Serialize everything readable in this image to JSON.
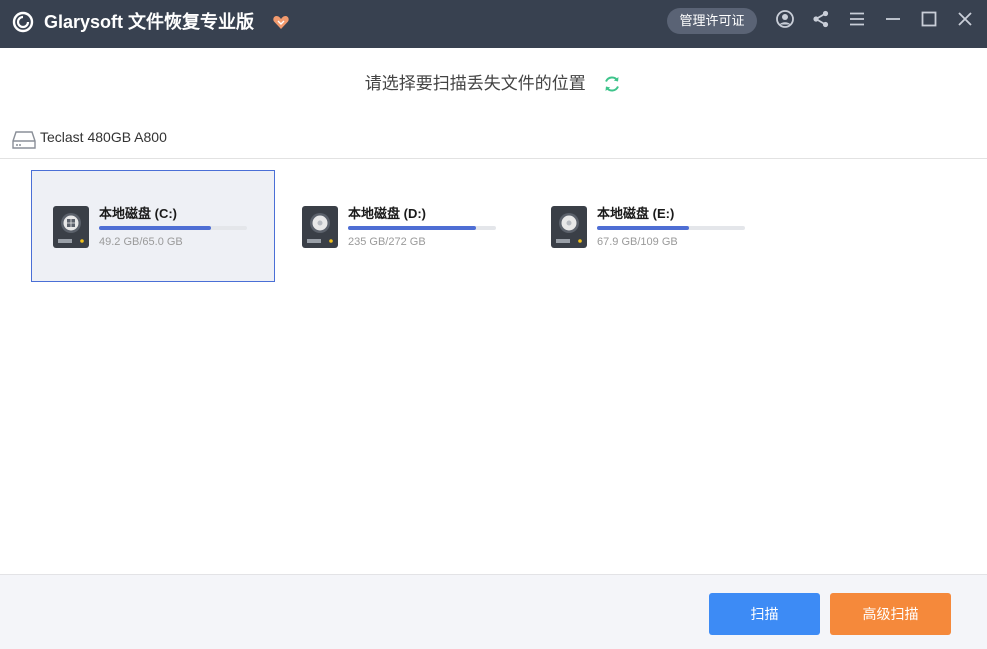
{
  "app": {
    "title": "Glarysoft 文件恢复专业版",
    "license_button": "管理许可证"
  },
  "heading": {
    "text": "请选择要扫描丢失文件的位置"
  },
  "device": {
    "name": "Teclast 480GB A800"
  },
  "drives": [
    {
      "label": "本地磁盘 (C:)",
      "size": "49.2 GB/65.0 GB",
      "used_fraction": 0.757,
      "selected": true
    },
    {
      "label": "本地磁盘 (D:)",
      "size": "235 GB/272 GB",
      "used_fraction": 0.864,
      "selected": false
    },
    {
      "label": "本地磁盘 (E:)",
      "size": "67.9 GB/109 GB",
      "used_fraction": 0.623,
      "selected": false
    }
  ],
  "footer": {
    "scan_button": "扫描",
    "advanced_scan_button": "高级扫描"
  },
  "colors": {
    "titlebar": "#384150",
    "accent_blue": "#3d8bf5",
    "accent_orange": "#f5893b",
    "progress": "#4e6ed4",
    "refresh_green": "#3ec48b"
  },
  "icons": [
    "app-logo-icon",
    "vip-heart-icon",
    "user-icon",
    "share-icon",
    "menu-icon",
    "minimize-icon",
    "maximize-icon",
    "close-icon",
    "refresh-icon",
    "hard-drive-icon",
    "windows-drive-icon",
    "disk-drive-icon"
  ]
}
